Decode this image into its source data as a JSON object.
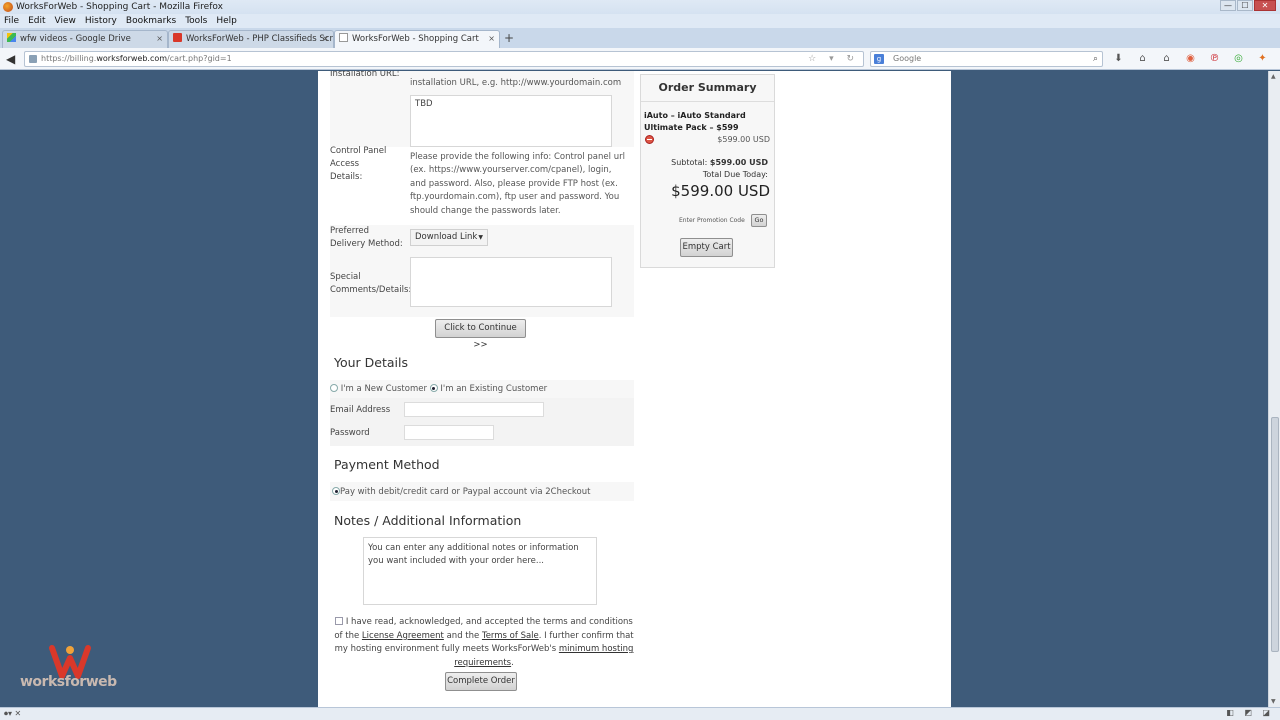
{
  "window": {
    "title": "WorksForWeb - Shopping Cart - Mozilla Firefox",
    "btn_min": "—",
    "btn_max": "☐",
    "btn_close": "✕"
  },
  "menu": [
    "File",
    "Edit",
    "View",
    "History",
    "Bookmarks",
    "Tools",
    "Help"
  ],
  "tabs": [
    {
      "label": "wfw videos - Google Drive"
    },
    {
      "label": "WorksForWeb - PHP Classifieds Scrip..."
    },
    {
      "label": "WorksForWeb - Shopping Cart"
    }
  ],
  "tab_close": "×",
  "new_tab": "+",
  "nav": {
    "back": "◀",
    "url_prefix": "https://billing.",
    "url_domain": "worksforweb.com",
    "url_path": "/cart.php?gid=1",
    "url_tools": "☆ ▾ ↻",
    "search_engine": "g",
    "search_placeholder": "Google",
    "search_icon": "⌕",
    "toolbar_icons": [
      "⬇",
      "⌂",
      "⌂",
      "◉",
      "℗",
      "◎",
      "✦"
    ]
  },
  "form": {
    "installation_url_label": "Installation URL:",
    "installation_url_hint": "installation URL, e.g. http://www.yourdomain.com",
    "installation_url_value": "TBD",
    "control_panel_label": "Control Panel Access Details:",
    "control_panel_hint": "Please provide the following info: Control panel url (ex. https://www.yourserver.com/cpanel), login, and password. Also, please provide FTP host (ex. ftp.yourdomain.com), ftp user and password. You should change the passwords later.",
    "delivery_label": "Preferred Delivery Method:",
    "delivery_value": "Download Link",
    "comments_label": "Special Comments/Details:",
    "continue_button": "Click to Continue >>"
  },
  "your_details": {
    "title": "Your Details",
    "new_customer": "I'm a New Customer",
    "existing_customer": "I'm an Existing Customer",
    "email_label": "Email Address",
    "password_label": "Password"
  },
  "payment": {
    "title": "Payment Method",
    "option": "Pay with debit/credit card or Paypal account via 2Checkout"
  },
  "notes": {
    "title": "Notes / Additional Information",
    "placeholder": "You can enter any additional notes or information you want included with your order here..."
  },
  "terms": {
    "text_1": "I have read, acknowledged, and accepted the terms and conditions of the",
    "license_link": "License Agreement",
    "and": "and the",
    "terms_link": "Terms of Sale",
    "text_2": ". I further confirm that my hosting environment fully meets WorksForWeb's",
    "hosting_link": "minimum hosting requirements",
    "period": "."
  },
  "complete_button": "Complete Order",
  "summary": {
    "title": "Order Summary",
    "product": "iAuto – iAuto Standard Ultimate Pack – $599",
    "line_price": "$599.00 USD",
    "subtotal_label": "Subtotal:",
    "subtotal_value": "$599.00 USD",
    "total_due_label": "Total Due Today:",
    "total": "$599.00 USD",
    "promo_label": "Enter Promotion Code",
    "go_button": "Go",
    "empty_cart": "Empty Cart"
  },
  "logo": {
    "text": "worksforweb"
  },
  "scroll": {
    "up": "▲",
    "down": "▼"
  },
  "status": {
    "left": "⏺▾  ✕",
    "right": "◧ ◩ ◪"
  },
  "colors": {
    "background": "#3e5b7a",
    "page": "#ffffff",
    "logo_red": "#d9382a"
  }
}
